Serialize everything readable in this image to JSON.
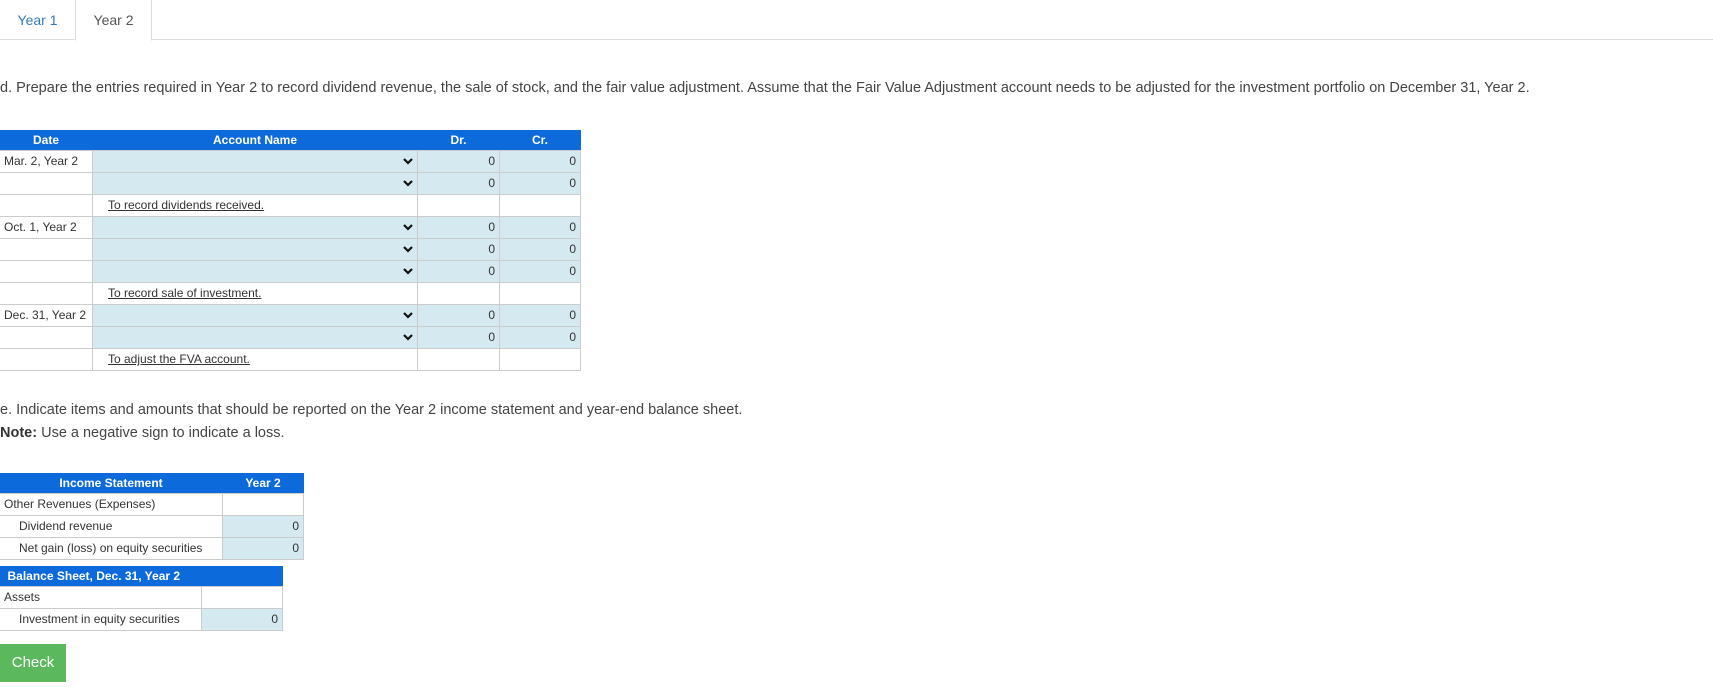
{
  "tabs": [
    {
      "label": "Year 1",
      "active": false
    },
    {
      "label": "Year 2",
      "active": true
    }
  ],
  "part_d": {
    "instruction": "d. Prepare the entries required in Year 2 to record dividend revenue, the sale of stock, and the fair value adjustment. Assume that the Fair Value Adjustment account needs to be adjusted for the investment portfolio on December 31, Year 2.",
    "headers": {
      "date": "Date",
      "account": "Account Name",
      "dr": "Dr.",
      "cr": "Cr."
    },
    "rows": [
      {
        "type": "entry",
        "date": "Mar. 2, Year 2",
        "account": "",
        "dr": "0",
        "cr": "0"
      },
      {
        "type": "entry",
        "date": "",
        "account": "",
        "dr": "0",
        "cr": "0"
      },
      {
        "type": "memo",
        "date": "",
        "memo": "To record dividends received."
      },
      {
        "type": "entry",
        "date": "Oct. 1, Year 2",
        "account": "",
        "dr": "0",
        "cr": "0"
      },
      {
        "type": "entry",
        "date": "",
        "account": "",
        "dr": "0",
        "cr": "0"
      },
      {
        "type": "entry",
        "date": "",
        "account": "",
        "dr": "0",
        "cr": "0"
      },
      {
        "type": "memo",
        "date": "",
        "memo": "To record sale of investment."
      },
      {
        "type": "entry",
        "date": "Dec. 31, Year 2",
        "account": "",
        "dr": "0",
        "cr": "0"
      },
      {
        "type": "entry",
        "date": "",
        "account": "",
        "dr": "0",
        "cr": "0"
      },
      {
        "type": "memo",
        "date": "",
        "memo": "To adjust the FVA account."
      }
    ]
  },
  "part_e": {
    "instruction": "e. Indicate items and amounts that should be reported on the Year 2 income statement and year-end balance sheet.",
    "note_label": "Note:",
    "note_text": " Use a negative sign to indicate a loss.",
    "income_statement": {
      "header": "Income Statement",
      "col": "Year 2",
      "section": "Other Revenues (Expenses)",
      "rows": [
        {
          "label": "Dividend revenue",
          "value": "0"
        },
        {
          "label": "Net gain (loss) on equity securities",
          "value": "0"
        }
      ]
    },
    "balance_sheet": {
      "header": "Balance Sheet, Dec. 31, Year 2",
      "section": "Assets",
      "rows": [
        {
          "label": "Investment in equity securities",
          "value": "0"
        }
      ]
    }
  },
  "check_button": "Check"
}
